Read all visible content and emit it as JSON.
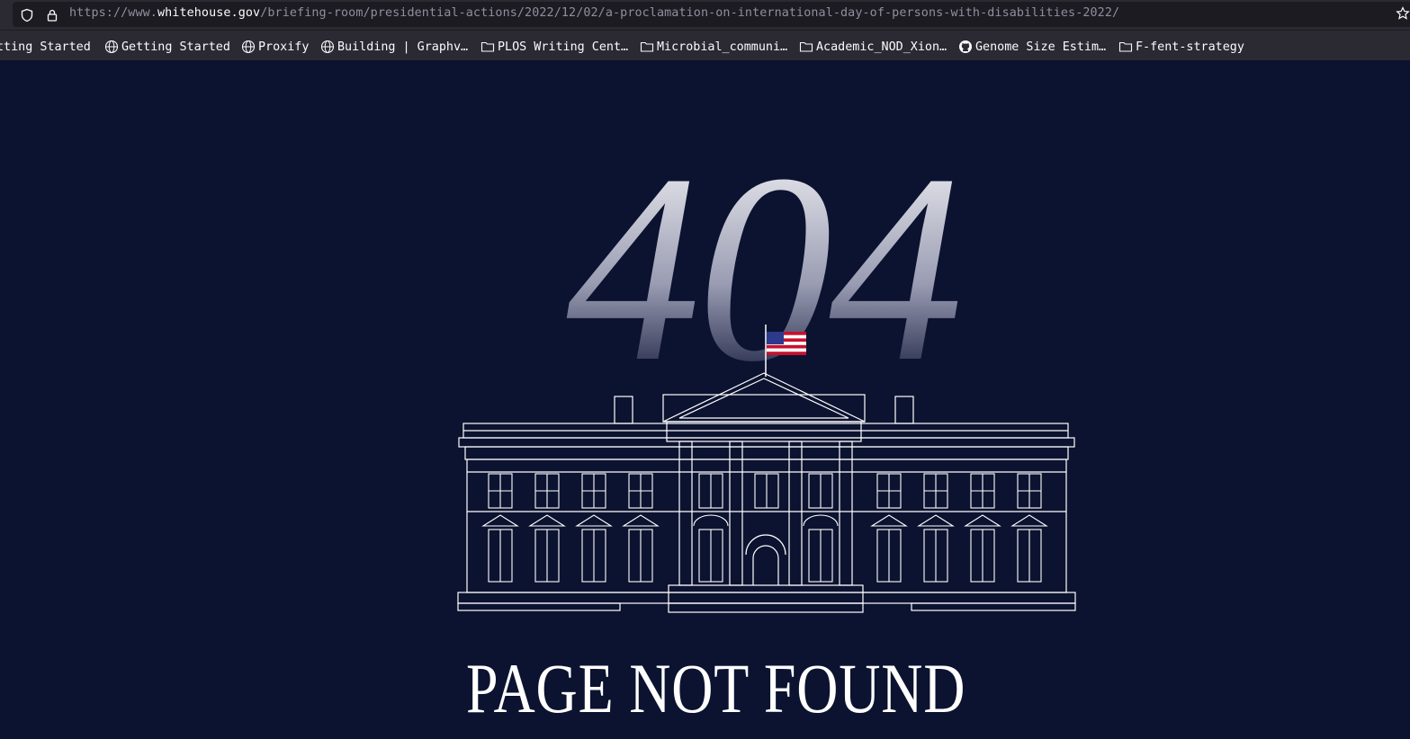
{
  "browser": {
    "url_prefix": "https://www.",
    "url_domain": "whitehouse.gov",
    "url_path": "/briefing-room/presidential-actions/2022/12/02/a-proclamation-on-international-day-of-persons-with-disabilities-2022/",
    "bookmarks": [
      {
        "label": "tting Started",
        "icon": "none"
      },
      {
        "label": "Getting Started",
        "icon": "globe-icon"
      },
      {
        "label": "Proxify",
        "icon": "globe-icon"
      },
      {
        "label": "Building | Graphv…",
        "icon": "globe-icon"
      },
      {
        "label": "PLOS Writing Cent…",
        "icon": "folder-icon"
      },
      {
        "label": "Microbial_communi…",
        "icon": "folder-icon"
      },
      {
        "label": "Academic_NOD_Xion…",
        "icon": "folder-icon"
      },
      {
        "label": "Genome Size Estim…",
        "icon": "github-icon"
      },
      {
        "label": "F-fent-strategy",
        "icon": "folder-icon"
      }
    ]
  },
  "page": {
    "error_code": "404",
    "heading": "PAGE NOT FOUND"
  },
  "colors": {
    "background": "#0c1330",
    "chrome": "#2b2a33",
    "heading": "#ffffff"
  }
}
